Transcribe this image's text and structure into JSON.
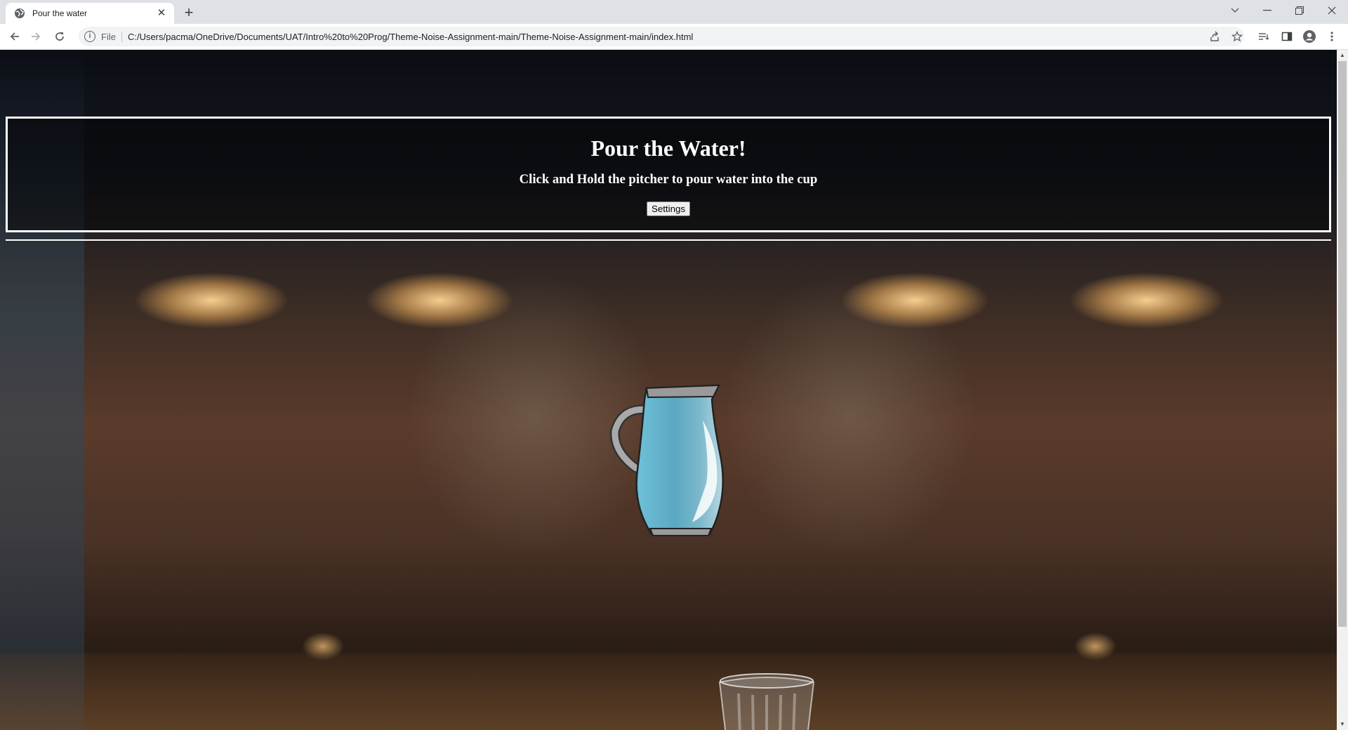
{
  "browser": {
    "tab_title": "Pour the water",
    "tab_close": "✕",
    "new_tab": "+",
    "scheme_label": "File",
    "url": "C:/Users/pacma/OneDrive/Documents/UAT/Intro%20to%20Prog/Theme-Noise-Assignment-main/Theme-Noise-Assignment-main/index.html"
  },
  "page": {
    "title": "Pour the Water!",
    "instructions": "Click and Hold the pitcher to pour water into the cup",
    "settings_label": "Settings"
  },
  "icons": {
    "favicon": "globe-icon",
    "back": "back-arrow-icon",
    "forward": "forward-arrow-icon",
    "reload": "reload-icon",
    "info": "info-icon",
    "share": "share-icon",
    "bookmark": "star-icon",
    "reading_list": "reading-list-icon",
    "side_panel": "side-panel-icon",
    "profile": "profile-icon",
    "menu": "kebab-menu-icon"
  }
}
